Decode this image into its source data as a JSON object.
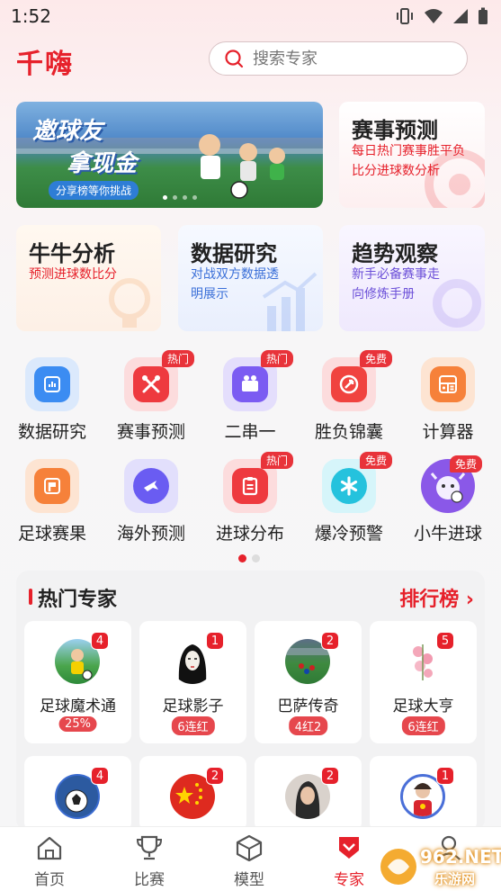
{
  "status": {
    "time": "1:52"
  },
  "header": {
    "logo": "千嗨",
    "search_placeholder": "搜索专家"
  },
  "banner": {
    "title_line1": "邀球友",
    "title_line2": "拿现金",
    "tag": "分享榜等你挑战"
  },
  "features": [
    {
      "title": "赛事预测",
      "sub": "每日热门赛事胜平负比分进球数分析",
      "color": "#e6212b"
    },
    {
      "title": "牛牛分析",
      "sub": "预测进球数比分",
      "color": "#e6212b"
    },
    {
      "title": "数据研究",
      "sub": "对战双方数据透明展示",
      "color": "#3a6fd8"
    },
    {
      "title": "趋势观察",
      "sub": "新手必备赛事走向修炼手册",
      "color": "#6b4fd8"
    }
  ],
  "grid": [
    {
      "label": "数据研究",
      "badge": "",
      "icon": "bar-chart-icon",
      "color": "#3b8cf2"
    },
    {
      "label": "赛事预测",
      "badge": "热门",
      "icon": "crossed-tools-icon",
      "color": "#ee3a3f"
    },
    {
      "label": "二串一",
      "badge": "热门",
      "icon": "projector-icon",
      "color": "#7b5cf2"
    },
    {
      "label": "胜负锦囊",
      "badge": "免费",
      "icon": "target-icon",
      "color": "#f0433f"
    },
    {
      "label": "计算器",
      "badge": "",
      "icon": "calculator-icon",
      "color": "#f6813a"
    },
    {
      "label": "足球赛果",
      "badge": "",
      "icon": "flag-icon",
      "color": "#f6813a"
    },
    {
      "label": "海外预测",
      "badge": "",
      "icon": "plane-icon",
      "color": "#6a5cf2"
    },
    {
      "label": "进球分布",
      "badge": "热门",
      "icon": "clipboard-icon",
      "color": "#ee3a3f"
    },
    {
      "label": "爆冷预警",
      "badge": "免费",
      "icon": "asterisk-icon",
      "color": "#25c2dd"
    },
    {
      "label": "小牛进球",
      "badge": "免费",
      "icon": "bull-mascot-icon",
      "color": "#8a58e8"
    }
  ],
  "experts": {
    "title": "热门专家",
    "rank_link": "排行榜 ›",
    "items": [
      {
        "name": "足球魔术通",
        "count": "4",
        "tag": "25%"
      },
      {
        "name": "足球影子",
        "count": "1",
        "tag": "6连红"
      },
      {
        "name": "巴萨传奇",
        "count": "2",
        "tag": "4红2"
      },
      {
        "name": "足球大亨",
        "count": "5",
        "tag": "6连红"
      },
      {
        "name": "",
        "count": "4",
        "tag": ""
      },
      {
        "name": "",
        "count": "2",
        "tag": ""
      },
      {
        "name": "",
        "count": "2",
        "tag": ""
      },
      {
        "name": "",
        "count": "1",
        "tag": ""
      }
    ]
  },
  "tabs": [
    {
      "label": "首页",
      "icon": "home-icon"
    },
    {
      "label": "比赛",
      "icon": "trophy-icon"
    },
    {
      "label": "模型",
      "icon": "cube-icon"
    },
    {
      "label": "专家",
      "icon": "expert-badge-icon",
      "active": true
    },
    {
      "label": "",
      "icon": "user-icon"
    }
  ],
  "watermark": {
    "text": "962.NET",
    "sub": "乐游网"
  }
}
